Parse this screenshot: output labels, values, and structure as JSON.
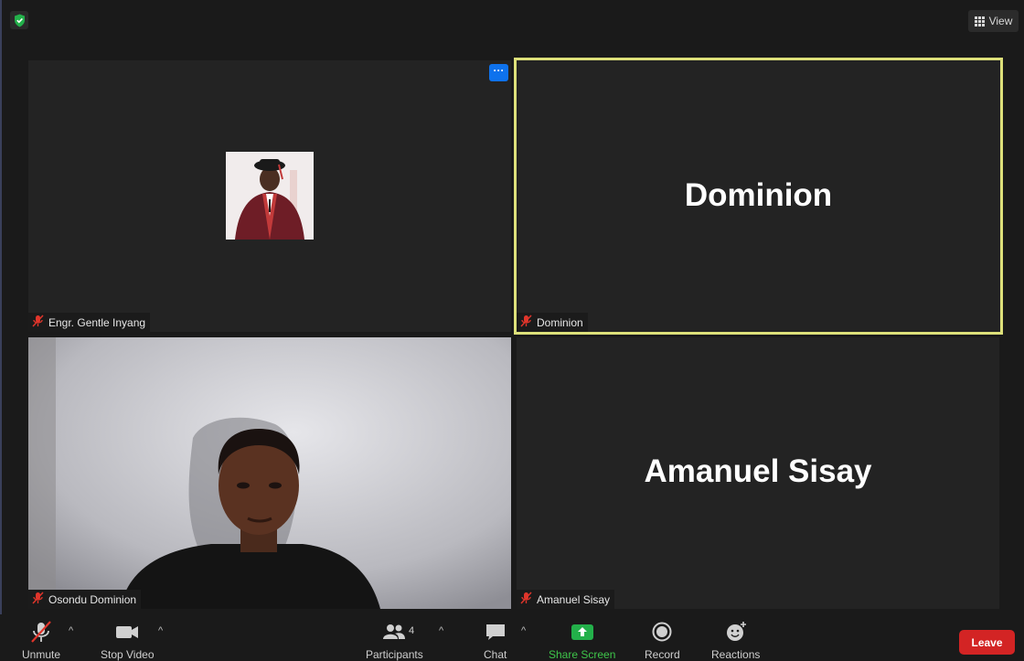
{
  "top_bar": {
    "security_icon": "shield-check-icon",
    "view_label": "View"
  },
  "tiles": [
    {
      "name": "Engr. Gentle Inyang",
      "display": "avatar-photo",
      "muted": true,
      "more_label": "···"
    },
    {
      "name": "Dominion",
      "display": "name-only",
      "big_text": "Dominion",
      "muted": true,
      "active_speaker": true
    },
    {
      "name": "Osondu Dominion",
      "display": "video",
      "muted": true
    },
    {
      "name": "Amanuel Sisay",
      "display": "name-only",
      "big_text": "Amanuel Sisay",
      "muted": true
    }
  ],
  "toolbar": {
    "unmute_label": "Unmute",
    "stop_video_label": "Stop Video",
    "participants_label": "Participants",
    "participants_count": "4",
    "chat_label": "Chat",
    "share_screen_label": "Share Screen",
    "record_label": "Record",
    "reactions_label": "Reactions",
    "leave_label": "Leave"
  },
  "colors": {
    "active_speaker_border": "#dde07a",
    "share_green": "#3ec54a",
    "leave_red": "#d32424",
    "more_button_blue": "#0e72ed",
    "mute_red": "#e0352b"
  }
}
